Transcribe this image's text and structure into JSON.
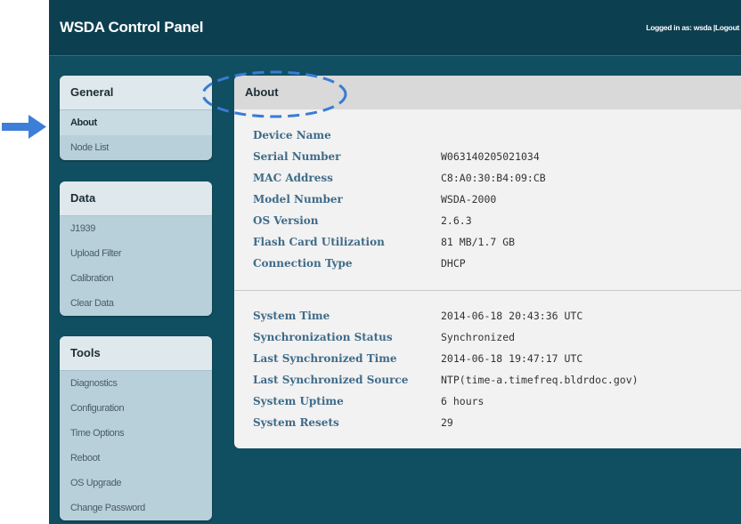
{
  "header": {
    "title": "WSDA Control Panel",
    "logged_in_text": "Logged in as: wsda",
    "separator": "|",
    "logout_label": "Logout"
  },
  "sidebar": {
    "general": {
      "title": "General",
      "items": [
        "About",
        "Node List"
      ]
    },
    "data": {
      "title": "Data",
      "items": [
        "J1939",
        "Upload Filter",
        "Calibration",
        "Clear Data"
      ]
    },
    "tools": {
      "title": "Tools",
      "items": [
        "Diagnostics",
        "Configuration",
        "Time Options",
        "Reboot",
        "OS Upgrade",
        "Change Password"
      ]
    },
    "active_item": "About"
  },
  "main": {
    "title": "About",
    "device": [
      {
        "label": "Device Name",
        "value": ""
      },
      {
        "label": "Serial Number",
        "value": "W063140205021034"
      },
      {
        "label": "MAC Address",
        "value": "C8:A0:30:B4:09:CB"
      },
      {
        "label": "Model Number",
        "value": "WSDA-2000"
      },
      {
        "label": "OS Version",
        "value": "2.6.3"
      },
      {
        "label": "Flash Card Utilization",
        "value": "81 MB/1.7 GB"
      },
      {
        "label": "Connection Type",
        "value": "DHCP"
      }
    ],
    "time": [
      {
        "label": "System Time",
        "value": "2014-06-18 20:43:36 UTC"
      },
      {
        "label": "Synchronization Status",
        "value": "Synchronized"
      },
      {
        "label": "Last Synchronized Time",
        "value": "2014-06-18 19:47:17 UTC"
      },
      {
        "label": "Last Synchronized Source",
        "value": "NTP(time-a.timefreq.bldrdoc.gov)"
      },
      {
        "label": "System Uptime",
        "value": "6 hours"
      },
      {
        "label": "System Resets",
        "value": "29"
      }
    ]
  },
  "colors": {
    "background": "#104e61",
    "header": "#0c3f50",
    "label": "#3f6b89",
    "annotation": "#3a7bd5"
  }
}
